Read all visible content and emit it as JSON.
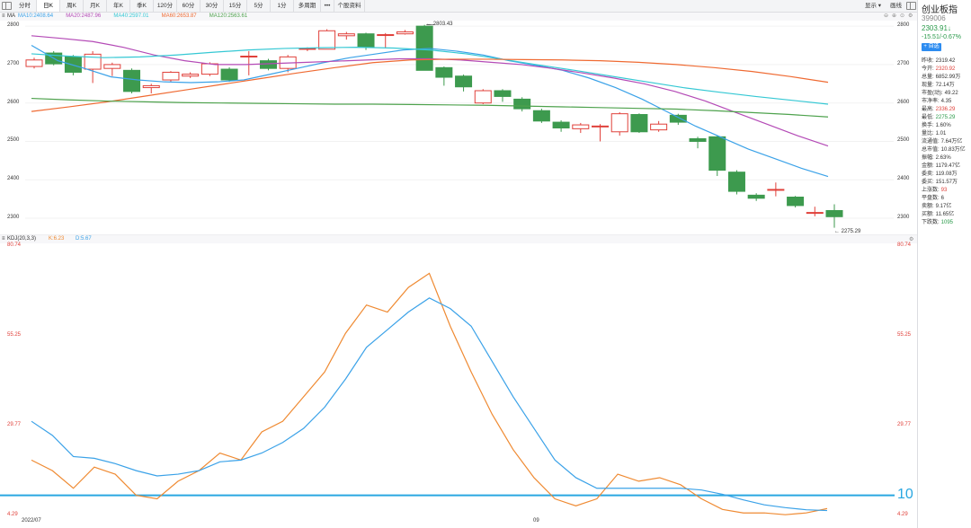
{
  "toolbar": {
    "tabs": [
      "分时",
      "日K",
      "周K",
      "月K",
      "年K",
      "季K",
      "120分",
      "60分",
      "30分",
      "15分",
      "5分",
      "1分",
      "多周期",
      "•••",
      "个股资料"
    ],
    "active_tab": "日K",
    "display_label": "显示",
    "draw_label": "画线"
  },
  "main_panel": {
    "label": "MA",
    "legend": [
      {
        "text": "MA10:2408.64",
        "color": "#3ba2e8"
      },
      {
        "text": "MA20:2487.96",
        "color": "#b44ab6"
      },
      {
        "text": "MA40:2597.01",
        "color": "#35c8d4"
      },
      {
        "text": "MA60:2653.87",
        "color": "#ef6a32"
      },
      {
        "text": "MA120:2563.61",
        "color": "#4ea24d"
      }
    ],
    "axis_ticks": [
      "2800",
      "2700",
      "2600",
      "2500",
      "2400",
      "2300"
    ],
    "high_label": "2803.43",
    "low_label": "2275.29"
  },
  "kdj_panel": {
    "label": "KDJ(20,3,3)",
    "legend": [
      {
        "text": "K:6.23",
        "color": "#ef8a32"
      },
      {
        "text": "D:5.67",
        "color": "#3ba2e8"
      }
    ],
    "axis_ticks": [
      "80.74",
      "55.25",
      "29.77",
      "4.29"
    ],
    "level_line_label": "10",
    "date_start": "2022/07",
    "date_mid": "09"
  },
  "quote_panel": {
    "name": "创业板指",
    "code": "399006",
    "price": "2303.91",
    "change": "-15.51/-0.67%",
    "add_button": "+ 自选",
    "rows": [
      {
        "k": "昨收:",
        "v": "2319.42",
        "c": "#333"
      },
      {
        "k": "今开:",
        "v": "2320.92",
        "c": "#e0403a"
      },
      {
        "k": "总量:",
        "v": "6852.99万",
        "c": "#333"
      },
      {
        "k": "现量:",
        "v": "72.14万",
        "c": "#333"
      },
      {
        "k": "市盈(动):",
        "v": "49.22",
        "c": "#333"
      },
      {
        "k": "市净率:",
        "v": "4.35",
        "c": "#333"
      },
      {
        "k": "最高:",
        "v": "2336.29",
        "c": "#e0403a"
      },
      {
        "k": "最低:",
        "v": "2275.29",
        "c": "#2a9a4a"
      },
      {
        "k": "换手:",
        "v": "1.60%",
        "c": "#333"
      },
      {
        "k": "量比:",
        "v": "1.01",
        "c": "#333"
      },
      {
        "k": "流通值:",
        "v": "7.64万亿",
        "c": "#333"
      },
      {
        "k": "总市值:",
        "v": "10.83万亿",
        "c": "#333"
      },
      {
        "k": "振幅:",
        "v": "2.63%",
        "c": "#333"
      },
      {
        "k": "金额:",
        "v": "1179.47亿",
        "c": "#333"
      },
      {
        "k": "委卖:",
        "v": "119.08万",
        "c": "#333"
      },
      {
        "k": "委买:",
        "v": "151.57万",
        "c": "#333"
      },
      {
        "k": "上涨数:",
        "v": "93",
        "c": "#e0403a"
      },
      {
        "k": "平盘数:",
        "v": "6",
        "c": "#333"
      },
      {
        "k": "卖额:",
        "v": "9.17亿",
        "c": "#333"
      },
      {
        "k": "买额:",
        "v": "11.65亿",
        "c": "#333"
      },
      {
        "k": "下跌数:",
        "v": "1095",
        "c": "#2a9a4a"
      }
    ]
  },
  "colors": {
    "up": "#e0403a",
    "down": "#3d9a4e",
    "k_line": "#ef8a32",
    "d_line": "#3ba2e8",
    "level_line": "#29a7e1"
  },
  "chart_data": [
    {
      "type": "candlestick",
      "title": "创业板指 日K",
      "ylim": [
        2260,
        2810
      ],
      "candles": [
        [
          2695,
          2712,
          2690,
          2718
        ],
        [
          2730,
          2702,
          2698,
          2735
        ],
        [
          2720,
          2680,
          2672,
          2725
        ],
        [
          2688,
          2727,
          2652,
          2735
        ],
        [
          2690,
          2700,
          2670,
          2705
        ],
        [
          2685,
          2630,
          2625,
          2690
        ],
        [
          2640,
          2645,
          2625,
          2650
        ],
        [
          2660,
          2680,
          2655,
          2683
        ],
        [
          2670,
          2675,
          2665,
          2680
        ],
        [
          2675,
          2702,
          2670,
          2706
        ],
        [
          2688,
          2660,
          2655,
          2693
        ],
        [
          2720,
          2722,
          2672,
          2735
        ],
        [
          2710,
          2690,
          2685,
          2715
        ],
        [
          2690,
          2720,
          2680,
          2725
        ],
        [
          2740,
          2742,
          2735,
          2745
        ],
        [
          2740,
          2788,
          2740,
          2792
        ],
        [
          2775,
          2780,
          2765,
          2785
        ],
        [
          2780,
          2745,
          2738,
          2783
        ],
        [
          2777,
          2778,
          2742,
          2782
        ],
        [
          2780,
          2785,
          2778,
          2790
        ],
        [
          2800,
          2685,
          2685,
          2803.43
        ],
        [
          2692,
          2667,
          2645,
          2695
        ],
        [
          2670,
          2642,
          2630,
          2674
        ],
        [
          2600,
          2632,
          2597,
          2636
        ],
        [
          2632,
          2617,
          2603,
          2636
        ],
        [
          2610,
          2585,
          2578,
          2615
        ],
        [
          2580,
          2553,
          2548,
          2585
        ],
        [
          2550,
          2535,
          2525,
          2555
        ],
        [
          2533,
          2543,
          2522,
          2548
        ],
        [
          2540,
          2540,
          2500,
          2545
        ],
        [
          2525,
          2572,
          2515,
          2576
        ],
        [
          2570,
          2525,
          2522,
          2573
        ],
        [
          2530,
          2545,
          2525,
          2553
        ],
        [
          2568,
          2550,
          2543,
          2572
        ],
        [
          2507,
          2500,
          2482,
          2512
        ],
        [
          2512,
          2425,
          2410,
          2515
        ],
        [
          2420,
          2370,
          2362,
          2425
        ],
        [
          2360,
          2352,
          2345,
          2365
        ],
        [
          2375,
          2375,
          2357,
          2393
        ],
        [
          2355,
          2333,
          2328,
          2358
        ],
        [
          2315,
          2315,
          2305,
          2330
        ],
        [
          2320,
          2304,
          2275.29,
          2336.29
        ]
      ],
      "series": [
        {
          "name": "MA10",
          "values": [
            2750,
            2710,
            2690,
            2668,
            2660,
            2655,
            2653,
            2655,
            2660,
            2675,
            2690,
            2705,
            2718,
            2728,
            2738,
            2742,
            2735,
            2725,
            2710,
            2698,
            2685,
            2665,
            2640,
            2610,
            2575,
            2540,
            2510,
            2480,
            2455,
            2430,
            2408.64
          ]
        },
        {
          "name": "MA20",
          "values": [
            2775,
            2768,
            2760,
            2745,
            2725,
            2710,
            2700,
            2700,
            2703,
            2706,
            2709,
            2712,
            2715,
            2715,
            2712,
            2706,
            2700,
            2690,
            2678,
            2665,
            2650,
            2630,
            2605,
            2575,
            2545,
            2515,
            2487.96
          ]
        },
        {
          "name": "MA40",
          "values": [
            2728,
            2722,
            2718,
            2720,
            2725,
            2732,
            2738,
            2742,
            2744,
            2745,
            2743,
            2738,
            2728,
            2714,
            2699,
            2685,
            2670,
            2655,
            2640,
            2628,
            2617,
            2607,
            2597.01
          ]
        },
        {
          "name": "MA60",
          "values": [
            2578,
            2590,
            2603,
            2618,
            2633,
            2648,
            2663,
            2678,
            2692,
            2705,
            2712,
            2714,
            2714,
            2713,
            2712,
            2710,
            2706,
            2700,
            2692,
            2682,
            2669,
            2653.87
          ]
        },
        {
          "name": "MA120",
          "values": [
            2612,
            2608,
            2605,
            2603,
            2601,
            2600,
            2599,
            2598,
            2597,
            2597,
            2596,
            2595,
            2594,
            2592,
            2590,
            2588,
            2586,
            2584,
            2580,
            2575,
            2570,
            2563.61
          ]
        }
      ]
    },
    {
      "type": "line",
      "title": "KDJ(20,3,3)",
      "ylim": [
        4.29,
        80.74
      ],
      "series": [
        {
          "name": "K",
          "values": [
            20,
            17,
            12,
            18,
            16,
            10,
            9,
            14,
            17,
            22,
            20,
            28,
            31,
            38,
            45,
            56,
            64,
            62,
            69,
            73,
            58,
            45,
            33,
            23,
            15,
            9,
            7,
            9,
            16,
            14,
            15,
            13,
            9,
            6,
            5,
            5,
            4.5,
            5,
            6.23
          ]
        },
        {
          "name": "D",
          "values": [
            31,
            27,
            21,
            20.5,
            19,
            17,
            15.5,
            16,
            17,
            19.5,
            20,
            22,
            25,
            29,
            35,
            43,
            52,
            57,
            62,
            66,
            63,
            58,
            48,
            38,
            29,
            20,
            15,
            12,
            12,
            12,
            12,
            12,
            11.5,
            10.3,
            8.7,
            7.3,
            6.5,
            5.9,
            5.67
          ]
        }
      ],
      "reference_line": 10
    }
  ]
}
